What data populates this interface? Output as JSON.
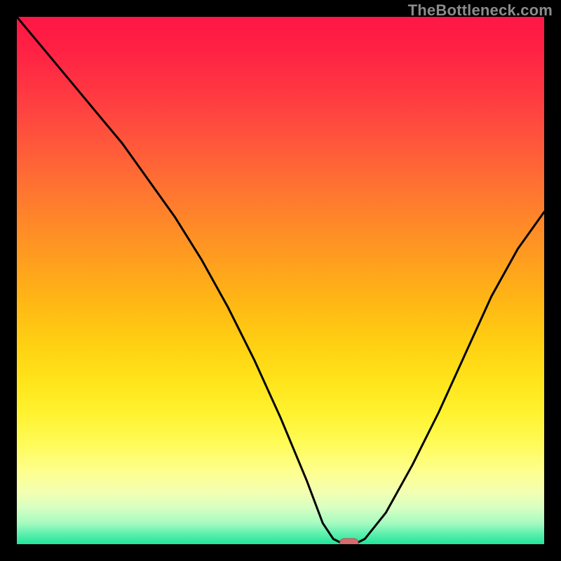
{
  "watermark": "TheBottleneck.com",
  "colors": {
    "frame": "#000000",
    "curve": "#000000",
    "marker_fill": "#d86a6f",
    "marker_stroke": "#b74e55",
    "gradient_stops": [
      {
        "offset": 0.0,
        "color": "#ff1745"
      },
      {
        "offset": 0.06,
        "color": "#ff2044"
      },
      {
        "offset": 0.13,
        "color": "#ff3442"
      },
      {
        "offset": 0.2,
        "color": "#ff4a3f"
      },
      {
        "offset": 0.27,
        "color": "#ff6138"
      },
      {
        "offset": 0.34,
        "color": "#ff7830"
      },
      {
        "offset": 0.41,
        "color": "#ff8e26"
      },
      {
        "offset": 0.48,
        "color": "#ffa41c"
      },
      {
        "offset": 0.55,
        "color": "#ffba14"
      },
      {
        "offset": 0.62,
        "color": "#ffd012"
      },
      {
        "offset": 0.69,
        "color": "#ffe41a"
      },
      {
        "offset": 0.75,
        "color": "#fff22f"
      },
      {
        "offset": 0.81,
        "color": "#fffb58"
      },
      {
        "offset": 0.86,
        "color": "#feff8c"
      },
      {
        "offset": 0.9,
        "color": "#f4ffb0"
      },
      {
        "offset": 0.93,
        "color": "#d8ffc2"
      },
      {
        "offset": 0.96,
        "color": "#a6fbc0"
      },
      {
        "offset": 0.98,
        "color": "#5ff0ae"
      },
      {
        "offset": 1.0,
        "color": "#20e59a"
      }
    ]
  },
  "chart_data": {
    "type": "line",
    "title": "",
    "xlabel": "",
    "ylabel": "",
    "xlim": [
      0,
      100
    ],
    "ylim": [
      0,
      100
    ],
    "x": [
      0,
      5,
      10,
      15,
      20,
      25,
      30,
      35,
      40,
      45,
      50,
      55,
      58,
      60,
      62,
      64,
      66,
      70,
      75,
      80,
      85,
      90,
      95,
      100
    ],
    "values": [
      100,
      94,
      88,
      82,
      76,
      69,
      62,
      54,
      45,
      35,
      24,
      12,
      4,
      1,
      0,
      0,
      1,
      6,
      15,
      25,
      36,
      47,
      56,
      63
    ],
    "minimum_marker": {
      "x": 63,
      "y": 0
    }
  }
}
